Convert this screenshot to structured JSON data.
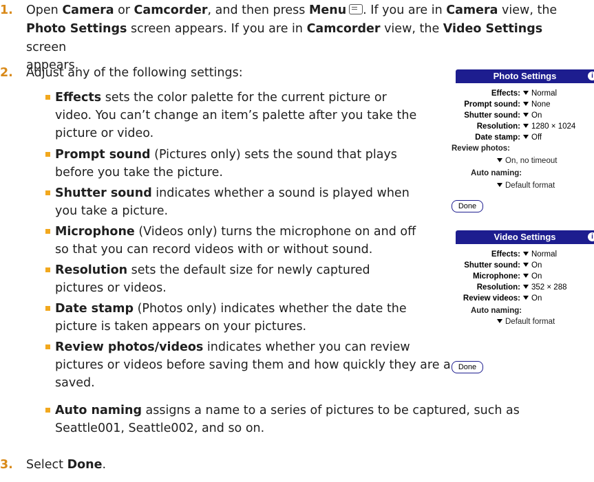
{
  "steps": [
    {
      "num": "1.",
      "parts": [
        {
          "t": "Open ",
          "b": false
        },
        {
          "t": "Camera",
          "b": true
        },
        {
          "t": " or ",
          "b": false
        },
        {
          "t": "Camcorder",
          "b": true
        },
        {
          "t": ", and then press ",
          "b": false
        },
        {
          "t": "Menu",
          "b": true
        },
        {
          "t": ". If you are in ",
          "b": false
        },
        {
          "t": "Camera",
          "b": true
        },
        {
          "t": " view, the",
          "b": false
        }
      ],
      "line2": [
        {
          "t": "Photo Settings",
          "b": true
        },
        {
          "t": " screen appears. If you are in ",
          "b": false
        },
        {
          "t": "Camcorder",
          "b": true
        },
        {
          "t": " view, the ",
          "b": false
        },
        {
          "t": "Video Settings",
          "b": true
        }
      ],
      "line3": "screen appears."
    },
    {
      "num": "2.",
      "text": "Adjust any of the following settings:"
    },
    {
      "num": "3.",
      "pre": "Select ",
      "bold": "Done",
      "post": "."
    }
  ],
  "bullets": [
    {
      "term": "Effects",
      "lines": [
        " sets the color palette for the current picture or",
        "video. You can’t change an item’s palette after you take the",
        "picture or video."
      ]
    },
    {
      "term": "Prompt sound",
      "lines": [
        " (Pictures only) sets the sound that plays",
        "before you take the picture."
      ]
    },
    {
      "term": "Shutter sound",
      "lines": [
        " indicates whether a sound is played when",
        "you take a picture."
      ]
    },
    {
      "term": "Microphone",
      "lines": [
        " (Videos only) turns the microphone on and off",
        "so that you can record videos with or without sound."
      ]
    },
    {
      "term": "Resolution",
      "lines": [
        " sets the default size for newly captured",
        "pictures or videos."
      ]
    },
    {
      "term": "Date stamp",
      "lines": [
        " (Photos only) indicates whether the date the",
        "picture is taken appears on your pictures."
      ]
    },
    {
      "term": "Review photos/videos",
      "lines": [
        " indicates whether you can review",
        "pictures or videos before saving them and how quickly they are automatically",
        "saved."
      ]
    },
    {
      "term": "Auto naming",
      "lines": [
        " assigns a name to a series of pictures to be captured, such as",
        "Seattle001, Seattle002, and so on."
      ]
    }
  ],
  "photo_panel": {
    "title": "Photo Settings",
    "info": "i",
    "effects_label": "Effects:",
    "effects": "Normal",
    "prompt_label": "Prompt sound:",
    "prompt": "None",
    "shutter_label": "Shutter sound:",
    "shutter": "On",
    "resolution_label": "Resolution:",
    "resolution": "1280 × 1024",
    "date_label": "Date stamp:",
    "date": "Off",
    "review_label": "Review photos:",
    "review": "On, no timeout",
    "auto_label": "Auto naming:",
    "auto": "Default format",
    "done": "Done"
  },
  "video_panel": {
    "title": "Video Settings",
    "info": "i",
    "effects_label": "Effects:",
    "effects": "Normal",
    "shutter_label": "Shutter sound:",
    "shutter": "On",
    "mic_label": "Microphone:",
    "mic": "On",
    "resolution_label": "Resolution:",
    "resolution": "352 × 288",
    "review_label": "Review videos:",
    "review": "On",
    "auto_label": "Auto naming:",
    "auto": "Default format",
    "done": "Done"
  }
}
